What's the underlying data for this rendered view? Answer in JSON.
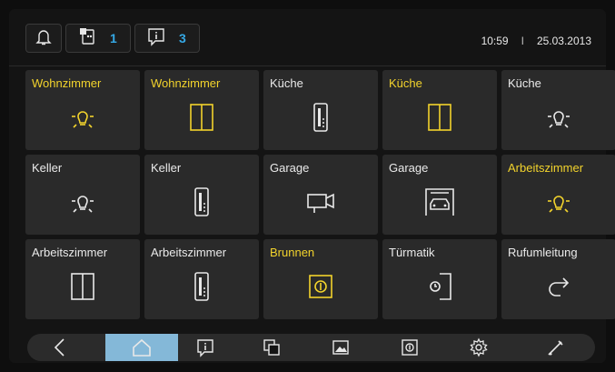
{
  "header": {
    "msg_count_1": "1",
    "msg_count_2": "3",
    "time": "10:59",
    "separator": "I",
    "date": "25.03.2013"
  },
  "tiles": [
    {
      "label": "Wohnzimmer",
      "icon": "light-icon",
      "active": true
    },
    {
      "label": "Wohnzimmer",
      "icon": "blinds-icon",
      "active": true
    },
    {
      "label": "Küche",
      "icon": "dimmer-icon",
      "active": false
    },
    {
      "label": "Küche",
      "icon": "blinds-icon",
      "active": true
    },
    {
      "label": "Küche",
      "icon": "light-icon",
      "active": false
    },
    {
      "label": "Keller",
      "icon": "light-icon",
      "active": false
    },
    {
      "label": "Keller",
      "icon": "dimmer-icon",
      "active": false
    },
    {
      "label": "Garage",
      "icon": "camera-icon",
      "active": false
    },
    {
      "label": "Garage",
      "icon": "garage-icon",
      "active": false
    },
    {
      "label": "Arbeitszimmer",
      "icon": "light-icon",
      "active": true
    },
    {
      "label": "Arbeitszimmer",
      "icon": "blinds-icon",
      "active": false
    },
    {
      "label": "Arbeitszimmer",
      "icon": "dimmer-icon",
      "active": false
    },
    {
      "label": "Brunnen",
      "icon": "switch-icon",
      "active": true
    },
    {
      "label": "Türmatik",
      "icon": "door-timer-icon",
      "active": false
    },
    {
      "label": "Rufumleitung",
      "icon": "call-forward-icon",
      "active": false
    }
  ],
  "nav": [
    {
      "name": "back-icon",
      "selected": false
    },
    {
      "name": "home-icon",
      "selected": true
    },
    {
      "name": "message-icon",
      "selected": false
    },
    {
      "name": "copy-icon",
      "selected": false
    },
    {
      "name": "picture-icon",
      "selected": false
    },
    {
      "name": "switch-icon",
      "selected": false
    },
    {
      "name": "settings-gear-icon",
      "selected": false
    },
    {
      "name": "tools-icon",
      "selected": false
    }
  ],
  "colors": {
    "active": "#f2d32c",
    "inactive": "#e8e8e8",
    "accent": "#35a9e6",
    "selected": "#84b8d8"
  }
}
